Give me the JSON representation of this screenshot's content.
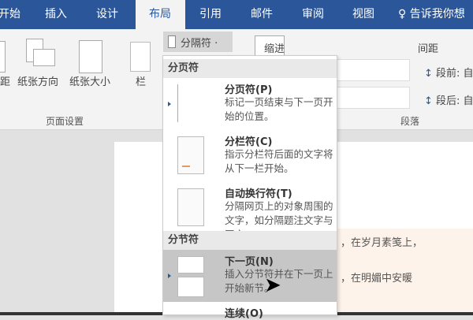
{
  "tabs": [
    "开始",
    "插入",
    "设计",
    "布局",
    "引用",
    "邮件",
    "审阅",
    "视图"
  ],
  "tell_me": "告诉我你想",
  "ribbon": {
    "margins": "距",
    "orientation": "纸张方向",
    "size": "纸张大小",
    "columns": "栏",
    "breaks": "分隔符 ·",
    "group_page_setup": "页面设置",
    "indent": "缩进",
    "spacing": "间距",
    "before": "段前: 自",
    "after": "段后: 自",
    "group_paragraph": "段落"
  },
  "menu": {
    "page_breaks_header": "分页符",
    "section_breaks_header": "分节符",
    "items": [
      {
        "title": "分页符(P)",
        "desc": "标记一页结束与下一页开始的位置。"
      },
      {
        "title": "分栏符(C)",
        "desc": "指示分栏符后面的文字将从下一栏开始。"
      },
      {
        "title": "自动换行符(T)",
        "desc": "分隔网页上的对象周围的文字，如分隔题注文字与正文。"
      },
      {
        "title": "下一页(N)",
        "desc": "插入分节符并在下一页上开始新节。"
      },
      {
        "title": "连续(O)",
        "desc": ""
      }
    ]
  },
  "document": {
    "line1": "，在岁月素笺上，",
    "line2": "，在明媚中安暖"
  }
}
